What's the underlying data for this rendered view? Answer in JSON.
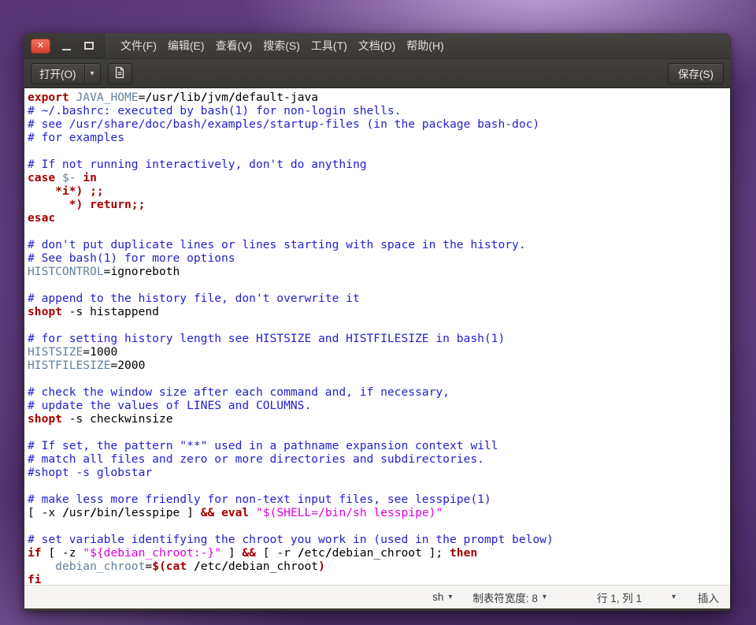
{
  "colors": {
    "close_button": "#e0453a",
    "titlebar_bg": "#3c3b37",
    "toolbar_bg": "#3b3a36",
    "editor_bg": "#ffffff",
    "statusbar_bg": "#f5f4f2",
    "desktop_accent": "#7b539b",
    "syntax": {
      "keyword": "#a40000",
      "comment": "#2222cc",
      "variable": "#64809d",
      "string": "#dd00dd",
      "plain": "#000000"
    }
  },
  "titlebar": {
    "menus": [
      {
        "name": "file",
        "label": "文件(F)"
      },
      {
        "name": "edit",
        "label": "编辑(E)"
      },
      {
        "name": "view",
        "label": "查看(V)"
      },
      {
        "name": "search",
        "label": "搜索(S)"
      },
      {
        "name": "tools",
        "label": "工具(T)"
      },
      {
        "name": "documents",
        "label": "文档(D)"
      },
      {
        "name": "help",
        "label": "帮助(H)"
      }
    ]
  },
  "toolbar": {
    "open_label": "打开(O)",
    "save_label": "保存(S)"
  },
  "statusbar": {
    "language": "sh",
    "tab_width": "制表符宽度: 8",
    "cursor_position": "行 1, 列 1",
    "mode": "插入"
  },
  "editor": {
    "lines": [
      [
        [
          "kw",
          "export"
        ],
        [
          "pl",
          " "
        ],
        [
          "var",
          "JAVA_HOME"
        ],
        [
          "pl",
          "="
        ],
        [
          "b",
          "/"
        ],
        [
          "pl",
          "usr"
        ],
        [
          "b",
          "/"
        ],
        [
          "pl",
          "lib"
        ],
        [
          "b",
          "/"
        ],
        [
          "pl",
          "jvm"
        ],
        [
          "b",
          "/"
        ],
        [
          "pl",
          "default-java"
        ]
      ],
      [
        [
          "cm",
          "# ~/.bashrc: executed by bash(1) for non-login shells."
        ]
      ],
      [
        [
          "cm",
          "# see /usr/share/doc/bash/examples/startup-files (in the package bash-doc)"
        ]
      ],
      [
        [
          "cm",
          "# for examples"
        ]
      ],
      [],
      [
        [
          "cm",
          "# If not running interactively, don't do anything"
        ]
      ],
      [
        [
          "kw",
          "case"
        ],
        [
          "pl",
          " "
        ],
        [
          "var",
          "$-"
        ],
        [
          "pl",
          " "
        ],
        [
          "kw",
          "in"
        ]
      ],
      [
        [
          "pl",
          "    "
        ],
        [
          "kw",
          "*i*)"
        ],
        [
          "pl",
          " "
        ],
        [
          "kw",
          ";;"
        ]
      ],
      [
        [
          "pl",
          "      "
        ],
        [
          "kw",
          "*)"
        ],
        [
          "pl",
          " "
        ],
        [
          "kw",
          "return;;"
        ]
      ],
      [
        [
          "kw",
          "esac"
        ]
      ],
      [],
      [
        [
          "cm",
          "# don't put duplicate lines or lines starting with space in the history."
        ]
      ],
      [
        [
          "cm",
          "# See bash(1) for more options"
        ]
      ],
      [
        [
          "var",
          "HISTCONTROL"
        ],
        [
          "pl",
          "=ignoreboth"
        ]
      ],
      [],
      [
        [
          "cm",
          "# append to the history file, don't overwrite it"
        ]
      ],
      [
        [
          "kw",
          "shopt"
        ],
        [
          "pl",
          " -s histappend"
        ]
      ],
      [],
      [
        [
          "cm",
          "# for setting history length see HISTSIZE and HISTFILESIZE in bash(1)"
        ]
      ],
      [
        [
          "var",
          "HISTSIZE"
        ],
        [
          "pl",
          "=1000"
        ]
      ],
      [
        [
          "var",
          "HISTFILESIZE"
        ],
        [
          "pl",
          "=2000"
        ]
      ],
      [],
      [
        [
          "cm",
          "# check the window size after each command and, if necessary,"
        ]
      ],
      [
        [
          "cm",
          "# update the values of LINES and COLUMNS."
        ]
      ],
      [
        [
          "kw",
          "shopt"
        ],
        [
          "pl",
          " -s checkwinsize"
        ]
      ],
      [],
      [
        [
          "cm",
          "# If set, the pattern \"**\" used in a pathname expansion context will"
        ]
      ],
      [
        [
          "cm",
          "# match all files and zero or more directories and subdirectories."
        ]
      ],
      [
        [
          "cm",
          "#shopt -s globstar"
        ]
      ],
      [],
      [
        [
          "cm",
          "# make less more friendly for non-text input files, see lesspipe(1)"
        ]
      ],
      [
        [
          "pl",
          "[ -x "
        ],
        [
          "b",
          "/"
        ],
        [
          "pl",
          "usr"
        ],
        [
          "b",
          "/"
        ],
        [
          "pl",
          "bin"
        ],
        [
          "b",
          "/"
        ],
        [
          "pl",
          "lesspipe ] "
        ],
        [
          "kw",
          "&&"
        ],
        [
          "pl",
          " "
        ],
        [
          "kw",
          "eval"
        ],
        [
          "pl",
          " "
        ],
        [
          "str",
          "\"$(SHELL=/bin/sh lesspipe)\""
        ]
      ],
      [],
      [
        [
          "cm",
          "# set variable identifying the chroot you work in (used in the prompt below)"
        ]
      ],
      [
        [
          "kw",
          "if"
        ],
        [
          "pl",
          " [ -z "
        ],
        [
          "str",
          "\"${debian_chroot:-}\""
        ],
        [
          "pl",
          " ] "
        ],
        [
          "kw",
          "&&"
        ],
        [
          "pl",
          " [ -r "
        ],
        [
          "b",
          "/"
        ],
        [
          "pl",
          "etc"
        ],
        [
          "b",
          "/"
        ],
        [
          "pl",
          "debian_chroot ]; "
        ],
        [
          "kw",
          "then"
        ]
      ],
      [
        [
          "pl",
          "    "
        ],
        [
          "var",
          "debian_chroot"
        ],
        [
          "pl",
          "="
        ],
        [
          "kw",
          "$(cat"
        ],
        [
          "pl",
          " "
        ],
        [
          "b",
          "/"
        ],
        [
          "pl",
          "etc"
        ],
        [
          "b",
          "/"
        ],
        [
          "pl",
          "debian_chroot"
        ],
        [
          "kw",
          ")"
        ]
      ],
      [
        [
          "kw",
          "fi"
        ]
      ]
    ]
  }
}
